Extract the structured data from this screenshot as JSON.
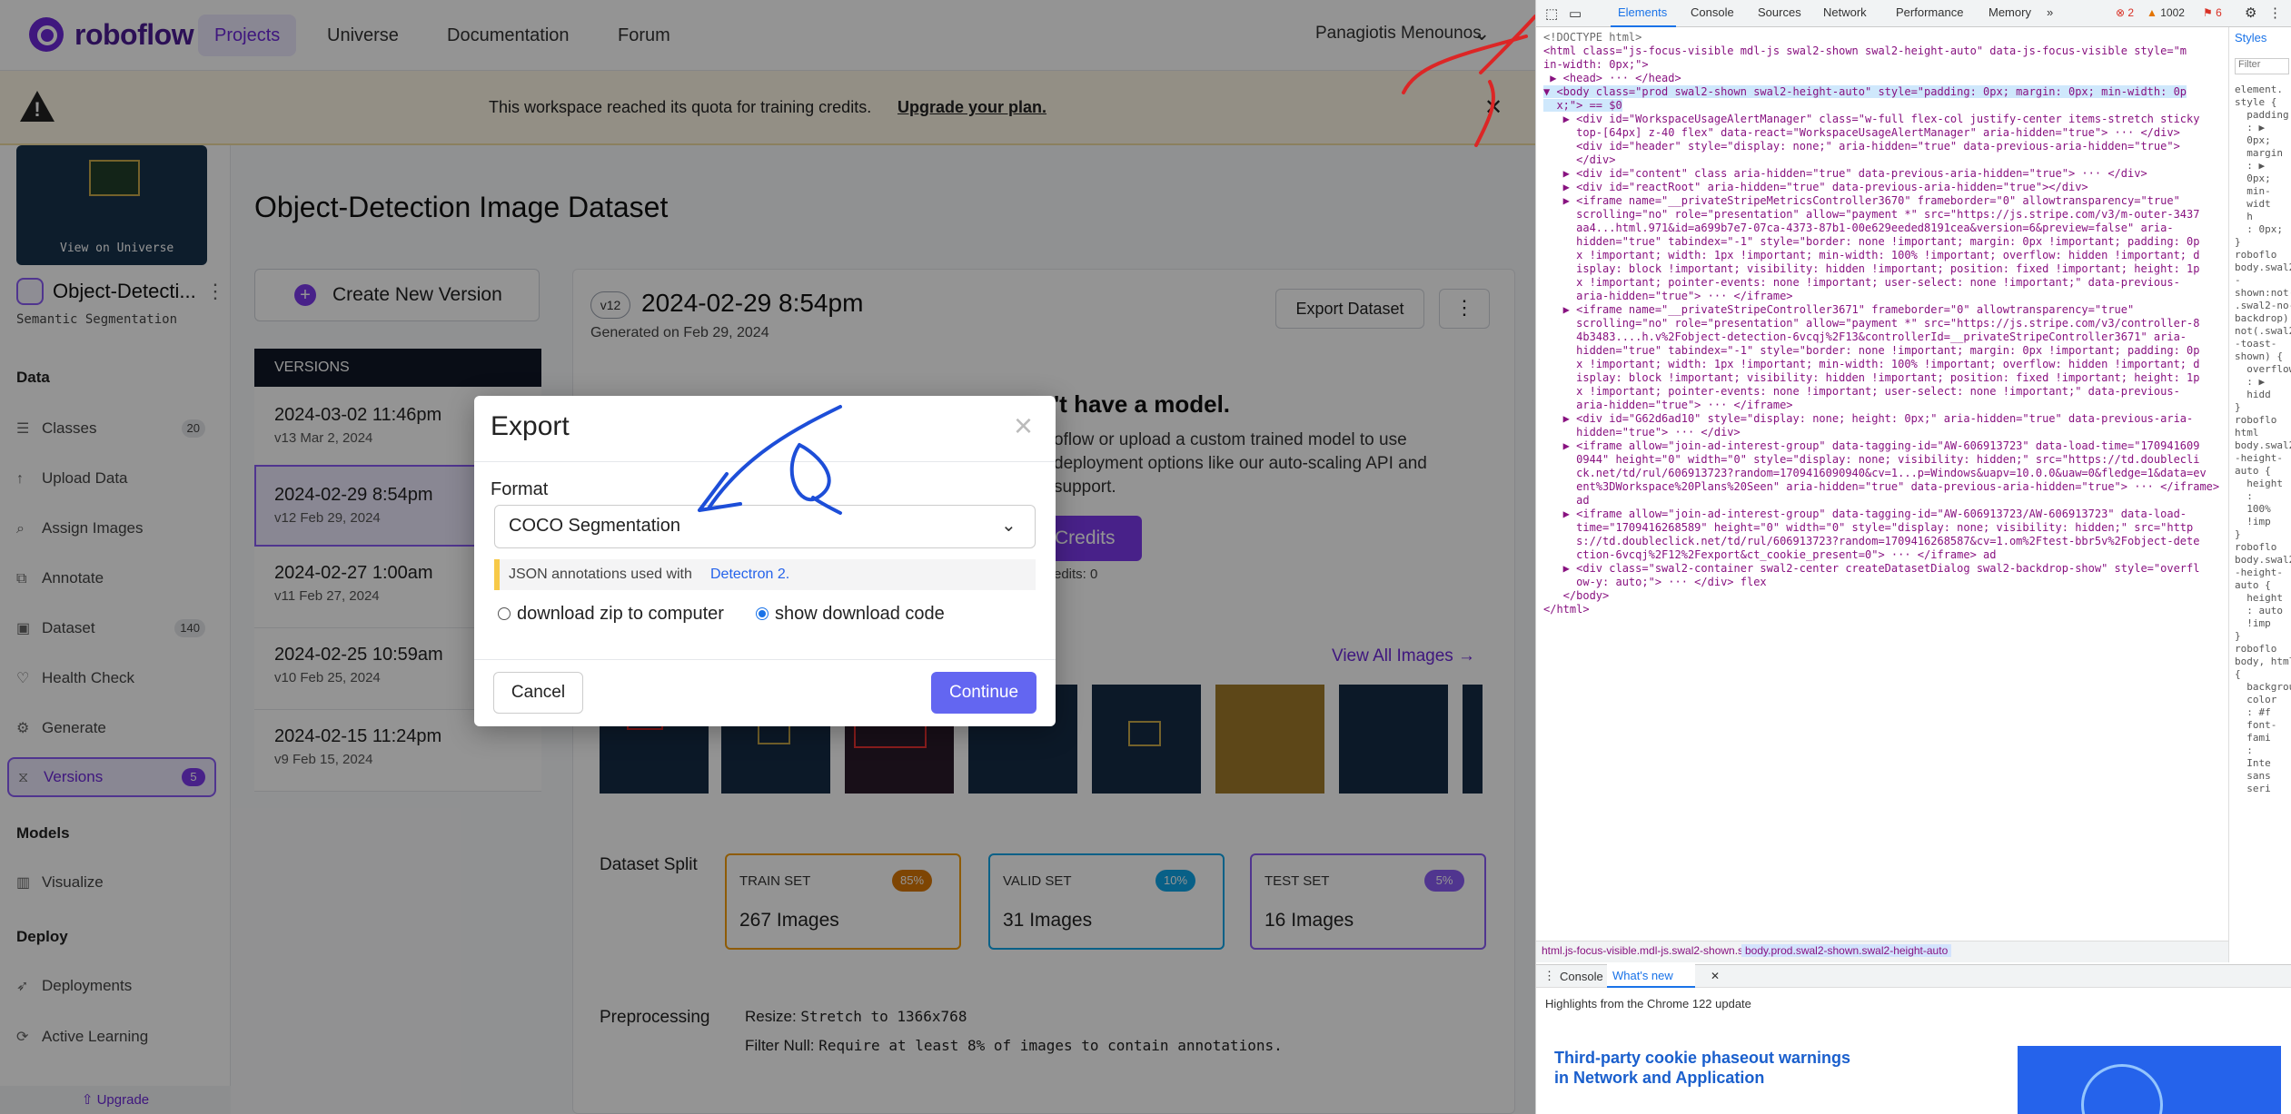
{
  "nav": {
    "logo": "roboflow",
    "links": [
      "Projects",
      "Universe",
      "Documentation",
      "Forum"
    ],
    "user": "Panagiotis Menounos"
  },
  "banner": {
    "text": "This workspace reached its quota for training credits.",
    "link": "Upgrade your plan."
  },
  "sidebar": {
    "thumb_label": "View on Universe",
    "project_name": "Object-Detecti...",
    "project_type": "Semantic Segmentation",
    "sections": {
      "data": "Data",
      "models": "Models",
      "deploy": "Deploy"
    },
    "items": [
      {
        "label": "Classes",
        "badge": "20"
      },
      {
        "label": "Upload Data"
      },
      {
        "label": "Assign Images"
      },
      {
        "label": "Annotate"
      },
      {
        "label": "Dataset",
        "badge": "140"
      },
      {
        "label": "Health Check"
      },
      {
        "label": "Generate"
      },
      {
        "label": "Versions",
        "badge": "5"
      },
      {
        "label": "Visualize"
      },
      {
        "label": "Deployments"
      },
      {
        "label": "Active Learning"
      }
    ],
    "upgrade": "Upgrade"
  },
  "main": {
    "title": "Object-Detection Image Dataset",
    "create_version": "Create New Version",
    "versions_header": "VERSIONS",
    "versions": [
      {
        "date": "2024-03-02 11:46pm",
        "sub": "v13 Mar 2, 2024"
      },
      {
        "date": "2024-02-29 8:54pm",
        "sub": "v12 Feb 29, 2024"
      },
      {
        "date": "2024-02-27 1:00am",
        "sub": "v11 Feb 27, 2024"
      },
      {
        "date": "2024-02-25 10:59am",
        "sub": "v10 Feb 25, 2024"
      },
      {
        "date": "2024-02-15 11:24pm",
        "sub": "v9 Feb 15, 2024"
      }
    ],
    "version_pill": "v12",
    "version_title": "2024-02-29 8:54pm",
    "generated": "Generated on Feb 29, 2024",
    "export_btn": "Export Dataset",
    "more_btn": "⋮",
    "no_model_title": "'t have a model.",
    "no_model_lines": [
      "oflow or upload a custom trained model to use",
      "deployment options like our auto-scaling API and",
      "support."
    ],
    "credits_btn": "Credits",
    "credits_text": "edits: 0",
    "view_all": "View All Images →",
    "split_label": "Dataset Split",
    "splits": [
      {
        "name": "TRAIN SET",
        "pct": "85%",
        "count": "267",
        "unit": "Images",
        "color": "#f59e0b"
      },
      {
        "name": "VALID SET",
        "pct": "10%",
        "count": "31",
        "unit": "Images",
        "color": "#0ea5e9"
      },
      {
        "name": "TEST SET",
        "pct": "5%",
        "count": "16",
        "unit": "Images",
        "color": "#8b5cf6"
      }
    ],
    "preprocessing_label": "Preprocessing",
    "resize_label": "Resize:",
    "resize_value": "Stretch to 1366x768",
    "filter_label": "Filter Null:",
    "filter_value": "Require at least 8% of images to contain annotations."
  },
  "modal": {
    "title": "Export",
    "format_label": "Format",
    "format_value": "COCO Segmentation",
    "note_text": "JSON annotations used with",
    "note_link": "Detectron 2.",
    "option1": "download zip to computer",
    "option2": "show download code",
    "cancel": "Cancel",
    "continue": "Continue"
  },
  "devtools": {
    "tabs": [
      "Elements",
      "Console",
      "Sources",
      "Network",
      "Performance",
      "Memory",
      "»"
    ],
    "errors": "2",
    "warnings": "1002",
    "issues": "6",
    "styles_tab": "Styles",
    "filter": "Filter",
    "crumbs": [
      "html.js-focus-visible.mdl-js.swal2-shown.swal2-height-auto",
      "body.prod.swal2-shown.swal2-height-auto"
    ],
    "drawer_tabs": [
      "Console",
      "What's new"
    ],
    "whats_new_header": "Highlights from the Chrome 122 update",
    "whats_new_title": "Third-party cookie phaseout warnings in Network and Application"
  }
}
